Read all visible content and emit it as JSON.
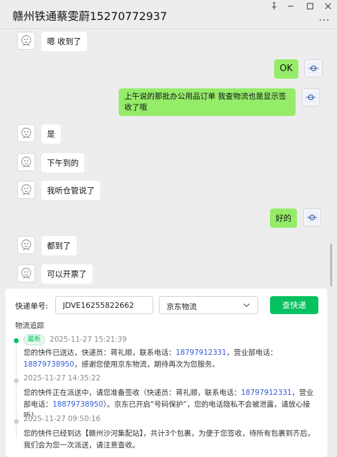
{
  "window": {
    "title": "赣州铁通蔡雯蔚15270772937",
    "controls": [
      "pin-icon",
      "minimize-icon",
      "maximize-icon",
      "close-icon"
    ],
    "more_label": "···"
  },
  "chat": {
    "messages": [
      {
        "from": "contact",
        "text": "嗯 收到了"
      },
      {
        "from": "me",
        "text": "OK"
      },
      {
        "from": "me",
        "text": "上午说的那批办公用品订单  我查物流也是显示签收了哦"
      },
      {
        "from": "contact",
        "text": "是"
      },
      {
        "from": "contact",
        "text": "下午到的"
      },
      {
        "from": "contact",
        "text": "我听仓管说了"
      },
      {
        "from": "me",
        "text": "好的"
      },
      {
        "from": "contact",
        "text": "都到了"
      },
      {
        "from": "contact",
        "text": "可以开票了"
      }
    ]
  },
  "express": {
    "tracking_label": "快递单号:",
    "tracking_value": "JDVE16255822662",
    "carrier": "京东物流",
    "query_button": "查快递",
    "log_title": "物流追踪",
    "latest_badge": "最新",
    "events": [
      {
        "time": "2025-11-27 15:21:39",
        "text_a": "您的快件已送达，快递员：蒋礼顺，联系电话：",
        "phone_a": "18797912331",
        "text_b": "，营业部电话：",
        "phone_b": "18879738950",
        "text_c": "，感谢您使用京东物流，期待再次为您服务。"
      },
      {
        "time": "2025-11-27 14:35:22",
        "text_a": "您的快件正在派送中，请您准备签收（快递员：蒋礼顺，联系电话：",
        "phone_a": "18797912331",
        "text_b": "，营业部电话：",
        "phone_b": "18879738950",
        "text_c": "）。京东已开启“号码保护”，您的电话隐私不会被泄露，请放心接听！"
      },
      {
        "time": "2025-11-27 09:50:16",
        "text_a": "您的快件已经到达【赣州沙河集配站】，共计3个包裹，为便于您签收，待所有包裹到齐后，我们会为您一次派送，请注意查收。"
      }
    ]
  },
  "colors": {
    "accent": "#07c160",
    "bubble_me": "#95ec69",
    "link": "#2e5bd6"
  }
}
